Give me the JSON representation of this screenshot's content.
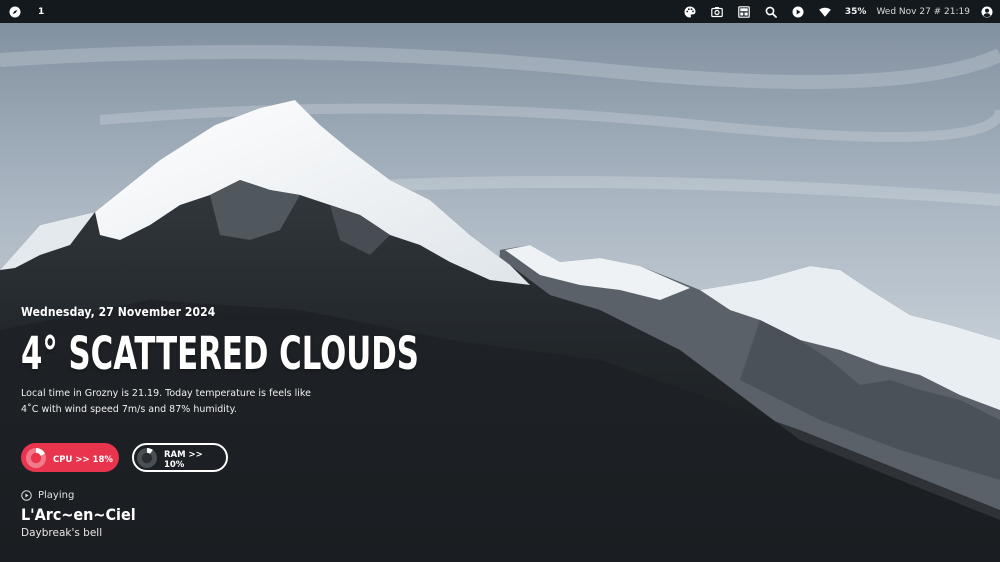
{
  "topbar": {
    "workspace": "1",
    "battery": "35%",
    "clock": "Wed Nov 27 # 21:19",
    "icons": [
      "compass-icon",
      "palette-icon",
      "camera-icon",
      "layout-icon",
      "search-icon",
      "play-circle-icon",
      "wifi-icon",
      "user-icon"
    ]
  },
  "weather": {
    "date": "Wednesday, 27 November 2024",
    "headline": "4° Scattered Clouds",
    "description": "Local time in Grozny is 21.19. Today temperature is feels like 4˚C with wind speed 7m/s and 87% humidity."
  },
  "stats": {
    "cpu": {
      "label": "CPU >> 18%",
      "percent": 18,
      "color": "#e8344d"
    },
    "ram": {
      "label": "RAM >> 10%",
      "percent": 10
    }
  },
  "player": {
    "status": "Playing",
    "artist": "L'Arc~en~Ciel",
    "title": "Daybreak's bell"
  },
  "colors": {
    "topbar_bg": "#13191d",
    "accent": "#e8344d"
  }
}
